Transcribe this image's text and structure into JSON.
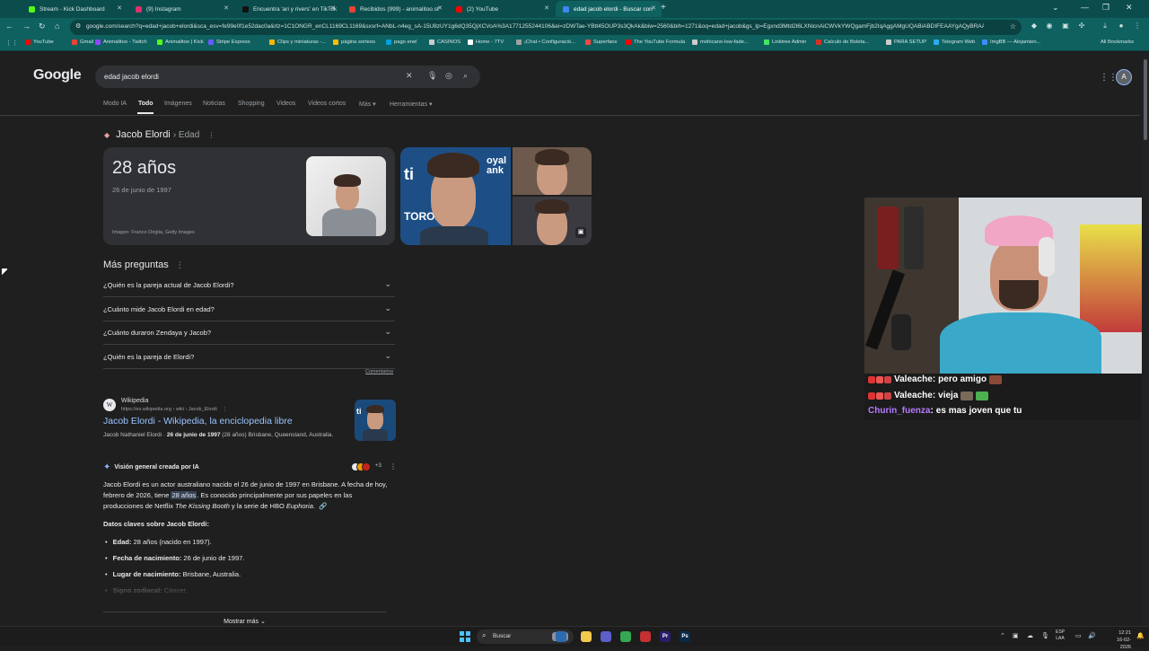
{
  "browser": {
    "tabs": [
      {
        "label": "Stream - Kick Dashboard",
        "fav_color": "#53fc18",
        "active": false
      },
      {
        "label": "(9) Instagram",
        "fav_color": "#e1306c",
        "active": false
      },
      {
        "label": "Encuentra 'ari y rivers' en TikTok",
        "fav_color": "#111111",
        "active": false
      },
      {
        "label": "Recibidos (999) - animalitoo.st",
        "fav_color": "#ea4335",
        "active": false
      },
      {
        "label": "(2) YouTube",
        "fav_color": "#ff0000",
        "active": false
      },
      {
        "label": "edad jacob elordi - Buscar con",
        "fav_color": "#4285f4",
        "active": true
      }
    ],
    "new_tab": "+",
    "url": "google.com/search?q=edad+jacob+elordi&sca_esv=fe99e0f1e52dac0a&rlz=1C1ONGR_enCL1169CL1169&sxsrf=ANbL-n4eg_sA-15U8zUY1g6dQ35QjXCVoA%3A1771255244106&ei=zDWTae-YBtt45OUP3s3QkAk&biw=2560&bih=1271&oq=edad+jacob&gs_lp=Egxnd3Mtd2l6LXNlcnAiCWVkYWQgamFjb2IqAggAMgUQABiABDIFEAAYgAQyBRAAGIAEMgUQABiABDIFEAAYgAQyBRAAGIAE"
  },
  "bookmarks": [
    {
      "label": "YouTube",
      "color": "#ff0000"
    },
    {
      "label": "Gmail",
      "color": "#ea4335"
    },
    {
      "label": "Animalitoo - Twitch",
      "color": "#9146ff"
    },
    {
      "label": "Animalitoo | Kick",
      "color": "#53fc18"
    },
    {
      "label": "Stripe Express",
      "color": "#635bff"
    },
    {
      "label": "Clips y miniaturas -...",
      "color": "#f4b400"
    },
    {
      "label": "página sorteos",
      "color": "#fbbc04"
    },
    {
      "label": "pago enel",
      "color": "#00a1e0"
    },
    {
      "label": "CASINOS",
      "color": "#cccccc"
    },
    {
      "label": "Home - 7TV",
      "color": "#ffffff"
    },
    {
      "label": "¡Chat • Configuració...",
      "color": "#a0a0a0"
    },
    {
      "label": "Superfans",
      "color": "#ff4444"
    },
    {
      "label": "The YouTube Formula",
      "color": "#ff0000"
    },
    {
      "label": "mohicano-low-fade...",
      "color": "#cccccc"
    },
    {
      "label": "Linktree Admin",
      "color": "#43e660"
    },
    {
      "label": "Calculo de Boleta...",
      "color": "#d93025"
    },
    {
      "label": "PARA SETUP",
      "color": "#cccccc"
    },
    {
      "label": "Telegram Web",
      "color": "#2aabee"
    },
    {
      "label": "ImgBB — Alojamien...",
      "color": "#3d8bff"
    }
  ],
  "all_bookmarks": "All Bookmarks",
  "google": {
    "logo": "Google",
    "query": "edad jacob elordi",
    "avatar_letter": "A",
    "nav_tabs": [
      {
        "label": "Modo IA",
        "active": false
      },
      {
        "label": "Todo",
        "active": true
      },
      {
        "label": "Imágenes",
        "active": false
      },
      {
        "label": "Noticias",
        "active": false
      },
      {
        "label": "Shopping",
        "active": false
      },
      {
        "label": "Videos",
        "active": false
      },
      {
        "label": "Videos cortos",
        "active": false
      },
      {
        "label": "Más ▾",
        "active": false
      },
      {
        "label": "Herramientas ▾",
        "active": false
      }
    ]
  },
  "answer": {
    "entity": "Jacob Elordi",
    "attribute": "› Edad",
    "age": "28 años",
    "birth_date": "26 de junio de 1997",
    "image_credit": "Imagen: Franco Origlia, Getty Images"
  },
  "paa": {
    "title": "Más preguntas",
    "questions": [
      "¿Quién es la pareja actual de Jacob Elordi?",
      "¿Cuánto mide Jacob Elordi en edad?",
      "¿Cuánto duraron Zendaya y Jacob?",
      "¿Quién es la pareja de Elordi?"
    ],
    "feedback": "Comentarios"
  },
  "wiki_result": {
    "site": "Wikipedia",
    "breadcrumb": "https://es.wikipedia.org › wiki › Jacob_Elordi",
    "title": "Jacob Elordi - Wikipedia, la enciclopedia libre",
    "snippet_a": "Jacob Nathaniel Elordi · ",
    "snippet_b": "26 de junio de 1997",
    "snippet_c": " (28 años) Brisbane, Queensland, Australia."
  },
  "ai_overview": {
    "header": "Visión general creada por IA",
    "source_count": "+3",
    "p1": "Jacob Elordi es un actor australiano nacido el 26 de junio de 1997 en Brisbane. A fecha de hoy, febrero de 2026, tiene ",
    "p1_highlight": "28 años",
    "p2": ". Es conocido principalmente por sus papeles en las producciones de Netflix ",
    "p2_italic1": "The Kissing Booth",
    "p3": " y la serie de HBO ",
    "p3_italic2": "Euphoria",
    "p4": ".",
    "key_heading": "Datos claves sobre Jacob Elordi:",
    "facts": [
      {
        "label": "Edad:",
        "value": " 28 años (nacido en 1997)."
      },
      {
        "label": "Fecha de nacimiento:",
        "value": " 26 de junio de 1997."
      },
      {
        "label": "Lugar de nacimiento:",
        "value": " Brisbane, Australia."
      },
      {
        "label": "Signo zodiacal:",
        "value": " Cáncer."
      }
    ],
    "show_more": "Mostrar más ⌄"
  },
  "chat": [
    {
      "user": "Valeache",
      "user_color": "#ffffff",
      "message": "pero amigo"
    },
    {
      "user": "Valeache",
      "user_color": "#ffffff",
      "message": "vieja"
    },
    {
      "user": "Churin_fuenza",
      "user_color": "#b57bff",
      "message": "es mas joven que tu"
    }
  ],
  "taskbar": {
    "search_label": "Buscar",
    "apps": [
      {
        "label": "",
        "color": "#2b6cb0"
      },
      {
        "label": "",
        "color": "#f2c94c"
      },
      {
        "label": "",
        "color": "#5b5fc7"
      },
      {
        "label": "",
        "color": "#34a853"
      },
      {
        "label": "",
        "color": "#c53030"
      },
      {
        "label": "Pr",
        "color": "#2a1b6b"
      },
      {
        "label": "Ps",
        "color": "#0a2a4a"
      }
    ],
    "lang_line1": "ESP",
    "lang_line2": "LAA",
    "time": "12:21",
    "date": "16-02-2026"
  }
}
